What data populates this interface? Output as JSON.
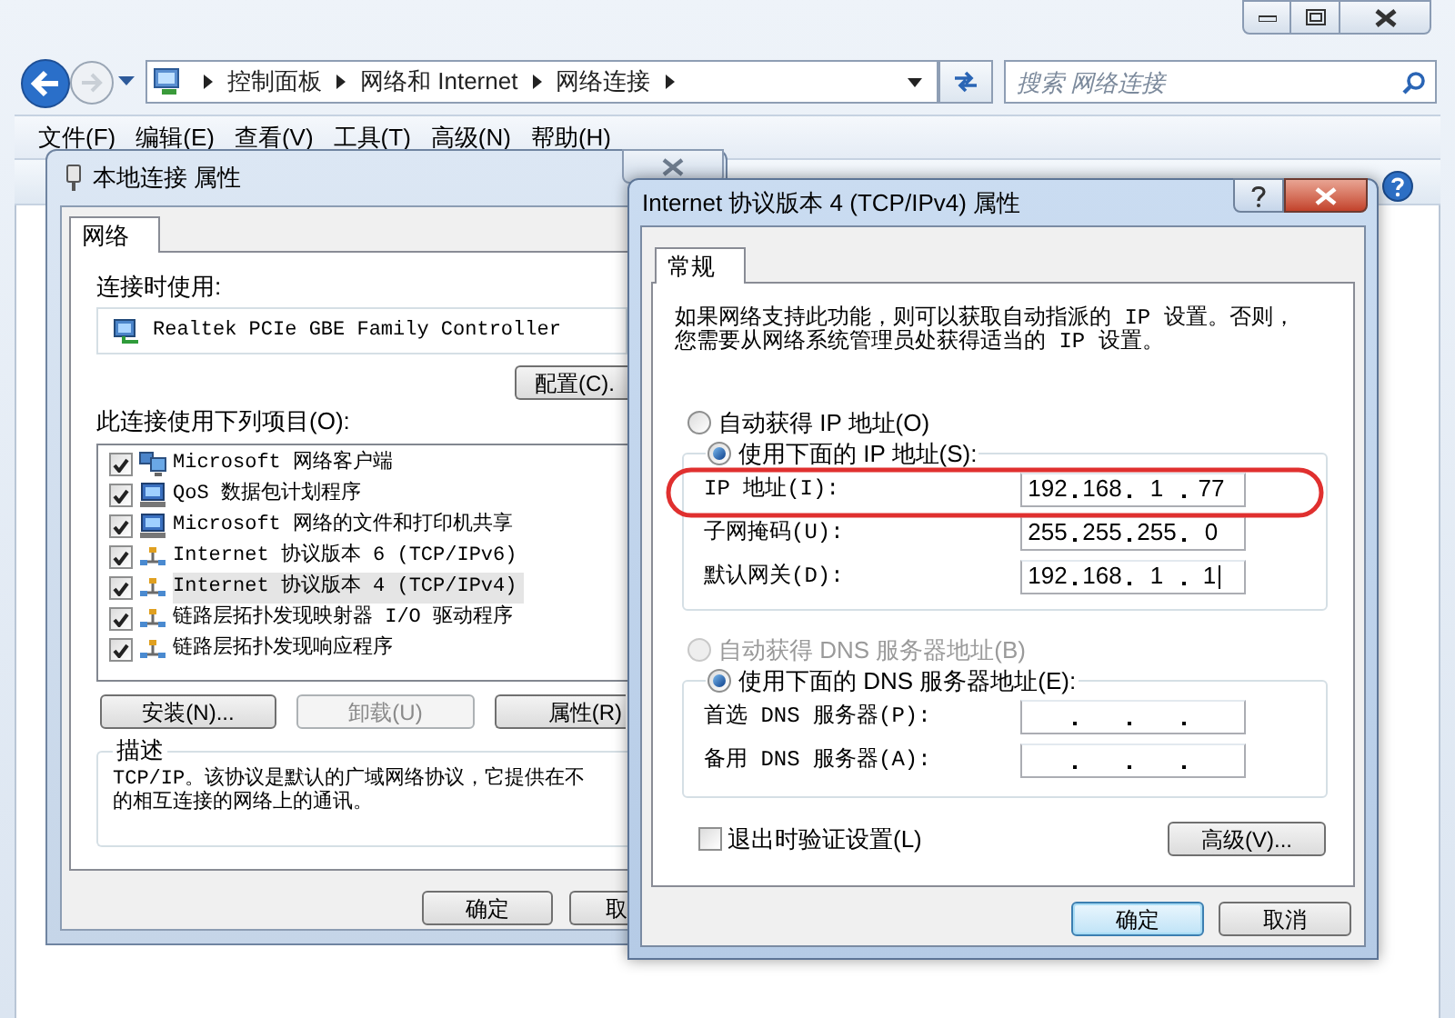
{
  "explorer": {
    "breadcrumb": [
      "控制面板",
      "网络和 Internet",
      "网络连接"
    ],
    "search": {
      "placeholder": "搜索 网络连接"
    },
    "menu": [
      "文件(F)",
      "编辑(E)",
      "查看(V)",
      "工具(T)",
      "高级(N)",
      "帮助(H)"
    ]
  },
  "connection_dialog": {
    "title": "本地连接 属性",
    "tabs": [
      {
        "label": "网络",
        "selected": true
      }
    ],
    "connect_using_label": "连接时使用:",
    "adapter": "Realtek PCIe GBE Family Controller",
    "configure_button": "配置(C).",
    "items_label": "此连接使用下列项目(O):",
    "items": [
      {
        "kind": "client",
        "label": "Microsoft 网络客户端",
        "checked": true,
        "selected": false
      },
      {
        "kind": "service",
        "label": "QoS 数据包计划程序",
        "checked": true,
        "selected": false
      },
      {
        "kind": "service",
        "label": "Microsoft 网络的文件和打印机共享",
        "checked": true,
        "selected": false
      },
      {
        "kind": "protocol",
        "label": "Internet 协议版本 6 (TCP/IPv6)",
        "checked": true,
        "selected": false
      },
      {
        "kind": "protocol",
        "label": "Internet 协议版本 4 (TCP/IPv4)",
        "checked": true,
        "selected": true
      },
      {
        "kind": "protocol",
        "label": "链路层拓扑发现映射器 I/O 驱动程序",
        "checked": true,
        "selected": false
      },
      {
        "kind": "protocol",
        "label": "链路层拓扑发现响应程序",
        "checked": true,
        "selected": false
      }
    ],
    "buttons": [
      {
        "label": "安装(N)...",
        "disabled": false
      },
      {
        "label": "卸载(U)",
        "disabled": true
      },
      {
        "label": "属性(R)",
        "disabled": false
      }
    ],
    "description": {
      "title": "描述",
      "lines": [
        "TCP/IP。该协议是默认的广域网络协议，它提供在不",
        "的相互连接的网络上的通讯。"
      ]
    },
    "footer_buttons": [
      "确定",
      "取"
    ]
  },
  "ipv4_dialog": {
    "title": "Internet 协议版本 4 (TCP/IPv4) 属性",
    "tabs": [
      {
        "label": "常规",
        "selected": true
      }
    ],
    "intro_lines": [
      "如果网络支持此功能，则可以获取自动指派的 IP 设置。否则，",
      "您需要从网络系统管理员处获得适当的 IP 设置。"
    ],
    "ip_mode": [
      {
        "label": "自动获得 IP 地址(O)",
        "selected": false,
        "disabled": false
      },
      {
        "label": "使用下面的 IP 地址(S):",
        "selected": true,
        "disabled": false
      }
    ],
    "ip_fields": [
      {
        "label": "IP 地址(I):",
        "octets": [
          "192",
          "168",
          "1",
          "77"
        ],
        "focused": false
      },
      {
        "label": "子网掩码(U):",
        "octets": [
          "255",
          "255",
          "255",
          "0"
        ],
        "focused": false
      },
      {
        "label": "默认网关(D):",
        "octets": [
          "192",
          "168",
          "1",
          "1"
        ],
        "focused": true
      }
    ],
    "dns_mode": [
      {
        "label": "自动获得 DNS 服务器地址(B)",
        "selected": false,
        "disabled": true
      },
      {
        "label": "使用下面的 DNS 服务器地址(E):",
        "selected": true,
        "disabled": false
      }
    ],
    "dns_fields": [
      {
        "label": "首选 DNS 服务器(P):",
        "focused": false
      },
      {
        "label": "备用 DNS 服务器(A):",
        "focused": false
      }
    ],
    "validate_checkbox": {
      "label": "退出时验证设置(L)",
      "checked": false
    },
    "advanced_button": "高级(V)...",
    "buttons": [
      {
        "label": "确定",
        "default": true
      },
      {
        "label": "取消",
        "default": false
      }
    ],
    "highlight": {
      "kind": "ellipse"
    }
  }
}
